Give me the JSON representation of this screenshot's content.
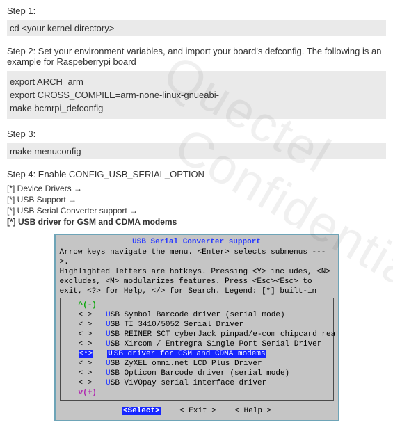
{
  "wm": "Quectel\n   Confidential",
  "step1": {
    "label": "Step 1:",
    "cmd": "cd <your kernel directory>"
  },
  "step2": {
    "label": "Step 2: Set your environment variables, and import your board's defconfig. The following is an example for Raspeberrypi board",
    "cmd1": "export ARCH=arm",
    "cmd2": "export CROSS_COMPILE=arm-none-linux-gnueabi-",
    "cmd3": "make bcmrpi_defconfig"
  },
  "step3": {
    "label": "Step 3:",
    "cmd": "make menuconfig"
  },
  "step4": {
    "label": "Step 4: Enable CONFIG_USB_SERIAL_OPTION",
    "nav": [
      "[*] Device Drivers →",
      "[*] USB Support →",
      "[*] USB Serial Converter support →",
      "[*] USB driver for GSM and CDMA modems"
    ]
  },
  "term": {
    "title": "USB Serial Converter support",
    "help": [
      {
        "pre": "Arrow keys navigate the menu.  <Enter> selects submenus --->.",
        "blue": ""
      },
      {
        "pre": "Highlighted letters are hotkeys.  Pressing <Y> includes, <N>",
        "blue": ""
      },
      {
        "pre": "excludes, <M> modularizes features.  Press <Esc><Esc> to",
        "blue": ""
      },
      {
        "pre": "exit, <?> for Help, </> for Search.  Legend: [*] built-in",
        "blue": ""
      }
    ],
    "top_marker": "^(-)",
    "bottom_marker": "v(+)",
    "items": [
      {
        "state": "< >",
        "hot": "U",
        "rest": "SB Symbol Barcode driver (serial mode)"
      },
      {
        "state": "< >",
        "hot": "U",
        "rest": "SB TI 3410/5052 Serial Driver"
      },
      {
        "state": "< >",
        "hot": "U",
        "rest": "SB REINER SCT cyberJack pinpad/e-com chipcard rea"
      },
      {
        "state": "< >",
        "hot": "U",
        "rest": "SB Xircom / Entregra Single Port Serial Driver"
      },
      {
        "state": "<*>",
        "hot": "U",
        "rest": "SB driver for GSM and CDMA modems",
        "selected": true
      },
      {
        "state": "< >",
        "hot": "U",
        "rest": "SB ZyXEL omni.net LCD Plus Driver"
      },
      {
        "state": "< >",
        "hot": "U",
        "rest": "SB Opticon Barcode driver (serial mode)"
      },
      {
        "state": "< >",
        "hot": "U",
        "rest": "SB ViVOpay serial interface driver"
      }
    ],
    "buttons": {
      "select": "<Select>",
      "exit": "< Exit >",
      "help": "< Help >"
    }
  }
}
